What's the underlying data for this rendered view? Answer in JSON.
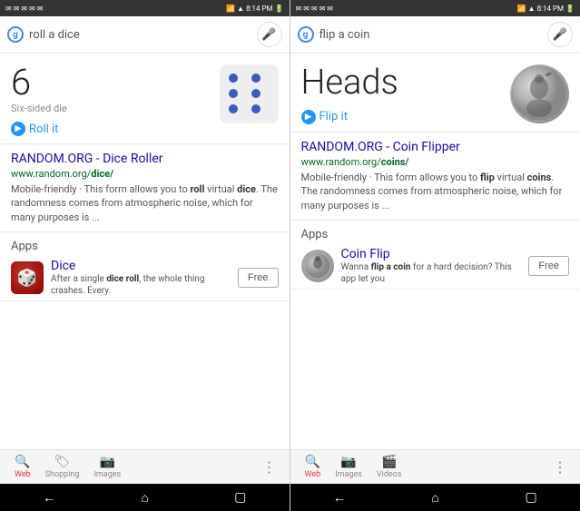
{
  "screen1": {
    "statusBar": {
      "time": "8:14 PM",
      "icons": [
        "envelope",
        "envelope",
        "signal",
        "wifi",
        "battery"
      ]
    },
    "searchQuery": "roll a dice",
    "result": {
      "number": "6",
      "label": "Six-sided die",
      "actionLabel": "Roll it"
    },
    "searchResult": {
      "title": "RANDOM.ORG - Dice Roller",
      "url": "www.random.org/dice/",
      "snippet": "Mobile-friendly · This form allows you to roll virtual dice. The randomness comes from atmospheric noise, which for many purposes is ..."
    },
    "appsLabel": "Apps",
    "app": {
      "name": "Dice",
      "description": "After a single dice roll, the whole thing crashes. Every.",
      "buttonLabel": "Free"
    },
    "bottomNav": {
      "items": [
        {
          "label": "Web",
          "active": true
        },
        {
          "label": "Shopping"
        },
        {
          "label": "Images"
        }
      ],
      "more": "⋮"
    }
  },
  "screen2": {
    "statusBar": {
      "time": "8:14 PM"
    },
    "searchQuery": "flip a coin",
    "result": {
      "text": "Heads",
      "actionLabel": "Flip it"
    },
    "searchResult": {
      "title": "RANDOM.ORG - Coin Flipper",
      "url": "www.random.org/coins/",
      "snippet": "Mobile-friendly · This form allows you to flip virtual coins. The randomness comes from atmospheric noise, which for many purposes is ..."
    },
    "appsLabel": "Apps",
    "app": {
      "name": "Coin Flip",
      "description": "Wanna flip a coin for a hard decision? This app let you",
      "buttonLabel": "Free"
    },
    "bottomNav": {
      "items": [
        {
          "label": "Web",
          "active": true
        },
        {
          "label": "Images"
        },
        {
          "label": "Videos"
        }
      ],
      "more": "⋮"
    }
  },
  "phoneNav": {
    "back": "←",
    "home": "⌂",
    "recent": "▢"
  }
}
